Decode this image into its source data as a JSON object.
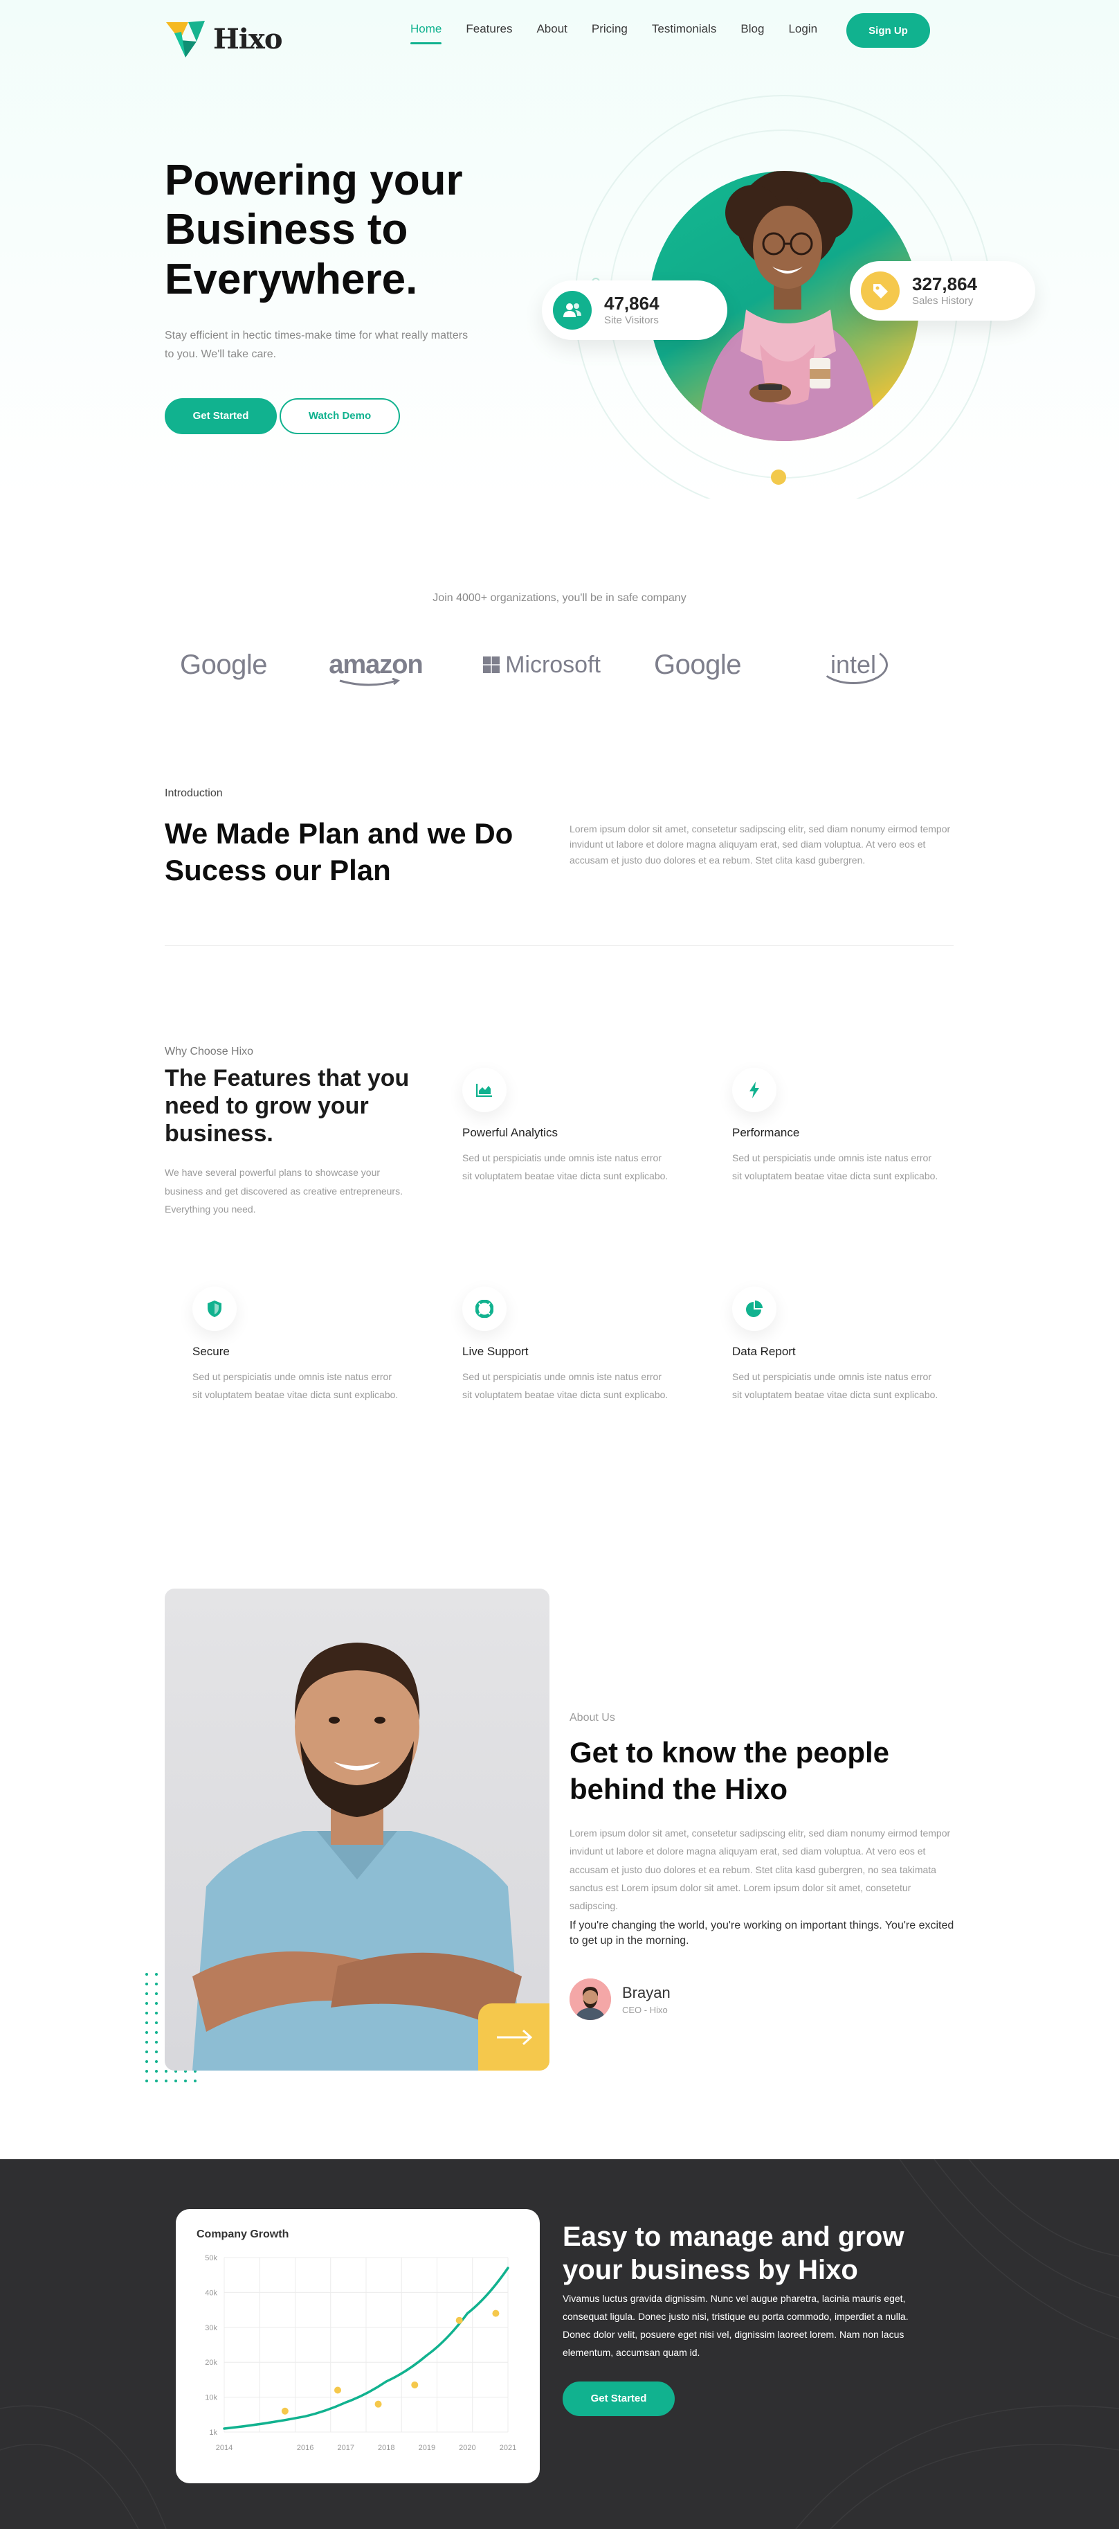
{
  "brand": {
    "name": "Hixo",
    "accent": "#11b28f",
    "yellow": "#f5c84c",
    "dark": "#2f2f31"
  },
  "nav": {
    "links": [
      "Home",
      "Features",
      "About",
      "Pricing",
      "Testimonials",
      "Blog",
      "Login"
    ],
    "active": "Home",
    "signup": "Sign Up"
  },
  "hero": {
    "title": "Powering your Business to Everywhere.",
    "subtitle": "Stay efficient in hectic times-make time for what really matters to you. We'll take care.",
    "primary_button": "Get Started",
    "secondary_button": "Watch Demo",
    "stats": [
      {
        "icon": "users-icon",
        "value": "47,864",
        "label": "Site Visitors"
      },
      {
        "icon": "tag-icon",
        "value": "327,864",
        "label": "Sales History"
      }
    ]
  },
  "partners": {
    "note": "Join 4000+ organizations, you'll be in safe company",
    "logos": [
      "Google",
      "amazon",
      "Microsoft",
      "Google",
      "intel"
    ]
  },
  "intro": {
    "tag": "Introduction",
    "title": "We Made Plan and we Do Sucess our Plan",
    "text": "Lorem ipsum dolor sit amet, consetetur sadipscing elitr, sed diam nonumy eirmod tempor invidunt ut labore et dolore magna aliquyam erat, sed diam voluptua. At vero eos et accusam et justo duo dolores et ea rebum. Stet clita kasd gubergren."
  },
  "features": {
    "tag": "Why Choose Hixo",
    "title": "The Features that you need to grow your business.",
    "subtitle": "We have several powerful plans to showcase your business and get discovered as creative entrepreneurs. Everything you need.",
    "items": [
      {
        "icon": "chart-area-icon",
        "name": "Powerful Analytics",
        "desc": "Sed ut perspiciatis unde omnis iste natus error sit voluptatem beatae vitae dicta sunt explicabo."
      },
      {
        "icon": "bolt-icon",
        "name": "Performance",
        "desc": "Sed ut perspiciatis unde omnis iste natus error sit voluptatem beatae vitae dicta sunt explicabo."
      },
      {
        "icon": "shield-icon",
        "name": "Secure",
        "desc": "Sed ut perspiciatis unde omnis iste natus error sit voluptatem beatae vitae dicta sunt explicabo."
      },
      {
        "icon": "lifebuoy-icon",
        "name": "Live Support",
        "desc": "Sed ut perspiciatis unde omnis iste natus error sit voluptatem beatae vitae dicta sunt explicabo."
      },
      {
        "icon": "pie-chart-icon",
        "name": "Data Report",
        "desc": "Sed ut perspiciatis unde omnis iste natus error sit voluptatem beatae vitae dicta sunt explicabo."
      }
    ]
  },
  "about": {
    "tag": "About Us",
    "title": "Get to know the people behind the Hixo",
    "text": "Lorem ipsum dolor sit amet, consetetur sadipscing elitr, sed diam nonumy eirmod tempor invidunt ut labore et dolore magna aliquyam erat, sed diam voluptua. At vero eos et accusam et justo duo dolores et ea rebum. Stet clita kasd gubergren, no sea takimata sanctus est Lorem ipsum dolor sit amet. Lorem ipsum dolor sit amet, consetetur sadipscing.",
    "quote": "If you're changing the world, you're working on important things. You're excited to get up in the morning.",
    "person": {
      "name": "Brayan",
      "role": "CEO - Hixo"
    }
  },
  "growth": {
    "title": "Easy to manage and grow your business by Hixo",
    "text": "Vivamus luctus gravida dignissim. Nunc vel augue pharetra, lacinia mauris eget, consequat ligula. Donec justo nisi, tristique eu porta commodo, imperdiet a nulla. Donec dolor velit, posuere eget nisi vel, dignissim laoreet lorem. Nam non lacus elementum, accumsan quam id.",
    "button": "Get Started"
  },
  "chart_data": {
    "type": "line",
    "title": "Company Growth",
    "x_ticks": [
      "2014",
      "2016",
      "2017",
      "2018",
      "2019",
      "2020",
      "2021"
    ],
    "y_ticks": [
      "50k",
      "40k",
      "30k",
      "20k",
      "10k",
      "1k"
    ],
    "xlim": [
      2014,
      2021
    ],
    "ylim": [
      0,
      50000
    ],
    "grid": true,
    "series": [
      {
        "type": "line",
        "x": [
          2014,
          2016,
          2017,
          2018,
          2019,
          2020,
          2021
        ],
        "y": [
          1000,
          4500,
          8500,
          14500,
          22000,
          34000,
          47000
        ]
      },
      {
        "type": "scatter",
        "x": [
          2015.5,
          2016.8,
          2017.8,
          2018.7,
          2019.8,
          2020.7
        ],
        "y": [
          6000,
          12000,
          8000,
          13500,
          32000,
          34000
        ]
      }
    ]
  }
}
